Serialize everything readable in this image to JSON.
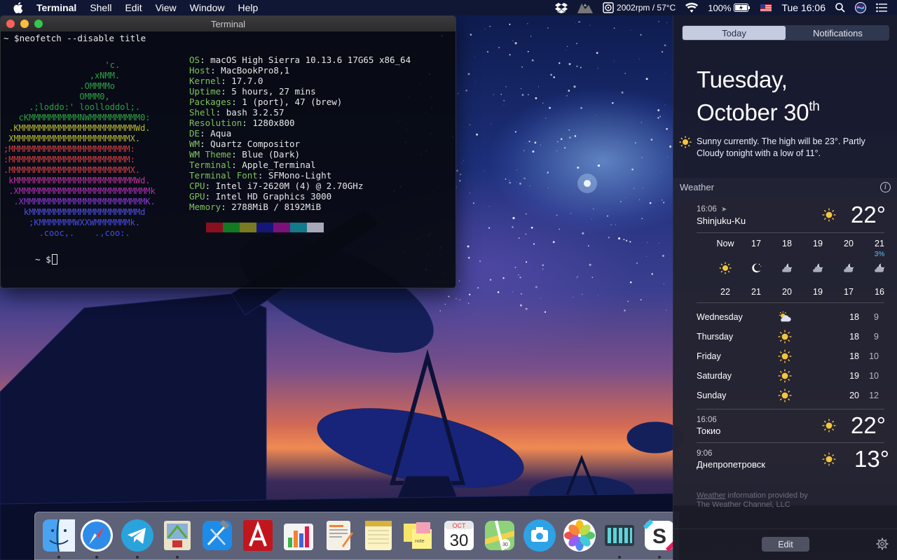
{
  "menubar": {
    "app": "Terminal",
    "menus": [
      "Shell",
      "Edit",
      "View",
      "Window",
      "Help"
    ],
    "fan_status": "2002rpm / 57°C",
    "battery": "100%",
    "clock": "Tue 16:06"
  },
  "terminal": {
    "title": "Terminal",
    "command_line": "~ $neofetch --disable title",
    "prompt": "~ $",
    "ascii_art": [
      {
        "text": "                    'c.",
        "color": "#2ea043"
      },
      {
        "text": "                 ,xNMM.",
        "color": "#2ea043"
      },
      {
        "text": "               .OMMMMo",
        "color": "#2ea043"
      },
      {
        "text": "               OMMM0,",
        "color": "#2ea043"
      },
      {
        "text": "     .;loddo:' loolloddol;.",
        "color": "#2ea043"
      },
      {
        "text": "   cKMMMMMMMMMMNWMMMMMMMMMM0:",
        "color": "#2ea043"
      },
      {
        "text": " .KMMMMMMMMMMMMMMMMMMMMMMMWd.",
        "color": "#b8b834"
      },
      {
        "text": " XMMMMMMMMMMMMMMMMMMMMMMMX.",
        "color": "#b8b834"
      },
      {
        "text": ";MMMMMMMMMMMMMMMMMMMMMMMM:",
        "color": "#d04040"
      },
      {
        "text": ":MMMMMMMMMMMMMMMMMMMMMMMM:",
        "color": "#d04040"
      },
      {
        "text": ".MMMMMMMMMMMMMMMMMMMMMMMMX.",
        "color": "#d04040"
      },
      {
        "text": " kMMMMMMMMMMMMMMMMMMMMMMMMWd.",
        "color": "#c0309a"
      },
      {
        "text": " .XMMMMMMMMMMMMMMMMMMMMMMMMMMk",
        "color": "#b030b0"
      },
      {
        "text": "  .XMMMMMMMMMMMMMMMMMMMMMMMMK.",
        "color": "#8a3ad0"
      },
      {
        "text": "    kMMMMMMMMMMMMMMMMMMMMMMd",
        "color": "#5050e0"
      },
      {
        "text": "     ;KMMMMMMMWXXWMMMMMMMk.",
        "color": "#4a4ae0"
      },
      {
        "text": "       .cooc,.    .,coo:.",
        "color": "#4a4ae0"
      }
    ],
    "info": [
      {
        "key": "OS",
        "value": "macOS High Sierra 10.13.6 17G65 x86_64"
      },
      {
        "key": "Host",
        "value": "MacBookPro8,1"
      },
      {
        "key": "Kernel",
        "value": "17.7.0"
      },
      {
        "key": "Uptime",
        "value": "5 hours, 27 mins"
      },
      {
        "key": "Packages",
        "value": "1 (port), 47 (brew)"
      },
      {
        "key": "Shell",
        "value": "bash 3.2.57"
      },
      {
        "key": "Resolution",
        "value": "1280x800"
      },
      {
        "key": "DE",
        "value": "Aqua"
      },
      {
        "key": "WM",
        "value": "Quartz Compositor"
      },
      {
        "key": "WM Theme",
        "value": "Blue (Dark)"
      },
      {
        "key": "Terminal",
        "value": "Apple_Terminal"
      },
      {
        "key": "Terminal Font",
        "value": "SFMono-Light"
      },
      {
        "key": "CPU",
        "value": "Intel i7-2620M (4) @ 2.70GHz"
      },
      {
        "key": "GPU",
        "value": "Intel HD Graphics 3000"
      },
      {
        "key": "Memory",
        "value": "2788MiB / 8192MiB"
      }
    ],
    "swatches": [
      "#8a1020",
      "#127a22",
      "#7a7a22",
      "#16167a",
      "#7a127a",
      "#127a8a",
      "#a8a8b8"
    ]
  },
  "notification_center": {
    "tabs": [
      "Today",
      "Notifications"
    ],
    "active_tab": "Today",
    "date_line1": "Tuesday,",
    "date_line2": "October 30",
    "date_suffix": "th",
    "summary": "Sunny currently. The high will be 23°. Partly Cloudy tonight with a low of 11°.",
    "weather_title": "Weather",
    "locations": [
      {
        "time": "16:06",
        "name": "Shinjuku-Ku",
        "temp": "22°",
        "icon": "sun-icon"
      },
      {
        "time": "16:06",
        "name": "Токио",
        "temp": "22°",
        "icon": "sun-icon"
      },
      {
        "time": "9:06",
        "name": "Днепропетровск",
        "temp": "13°",
        "icon": "sun-icon"
      }
    ],
    "hourly": [
      {
        "hour": "Now",
        "icon": "sun-icon",
        "temp": "22",
        "precip": ""
      },
      {
        "hour": "17",
        "icon": "moon-icon",
        "temp": "21",
        "precip": ""
      },
      {
        "hour": "18",
        "icon": "partly-cloudy-night-icon",
        "temp": "20",
        "precip": ""
      },
      {
        "hour": "19",
        "icon": "partly-cloudy-night-icon",
        "temp": "19",
        "precip": ""
      },
      {
        "hour": "20",
        "icon": "partly-cloudy-night-icon",
        "temp": "17",
        "precip": ""
      },
      {
        "hour": "21",
        "icon": "partly-cloudy-night-icon",
        "temp": "16",
        "precip": "3%"
      }
    ],
    "daily": [
      {
        "day": "Wednesday",
        "icon": "partly-cloudy-icon",
        "high": "18",
        "low": "9"
      },
      {
        "day": "Thursday",
        "icon": "sun-icon",
        "high": "18",
        "low": "9"
      },
      {
        "day": "Friday",
        "icon": "sun-icon",
        "high": "18",
        "low": "10"
      },
      {
        "day": "Saturday",
        "icon": "sun-icon",
        "high": "19",
        "low": "10"
      },
      {
        "day": "Sunday",
        "icon": "sun-icon",
        "high": "20",
        "low": "12"
      }
    ],
    "credit_link": "Weather",
    "credit_text": " information provided by",
    "credit_line2": "The Weather Channel, LLC",
    "edit_label": "Edit"
  },
  "dock": {
    "apps": [
      {
        "name": "finder-icon",
        "running": true
      },
      {
        "name": "safari-icon",
        "running": true
      },
      {
        "name": "telegram-icon",
        "running": true
      },
      {
        "name": "mail-icon",
        "running": true
      },
      {
        "name": "xcode-icon",
        "running": false
      },
      {
        "name": "autocad-icon",
        "running": false
      },
      {
        "name": "numbers-icon",
        "running": false
      },
      {
        "name": "pages-icon",
        "running": false
      },
      {
        "name": "notes-icon",
        "running": false
      },
      {
        "name": "stickies-icon",
        "running": false
      },
      {
        "name": "calendar-icon",
        "running": false
      },
      {
        "name": "maps-icon",
        "running": false
      },
      {
        "name": "screenshot-icon",
        "running": false
      },
      {
        "name": "photos-icon",
        "running": false
      },
      {
        "name": "istat-icon",
        "running": true
      },
      {
        "name": "slack-icon",
        "running": true
      }
    ],
    "calendar_month": "OCT",
    "calendar_day": "30"
  }
}
